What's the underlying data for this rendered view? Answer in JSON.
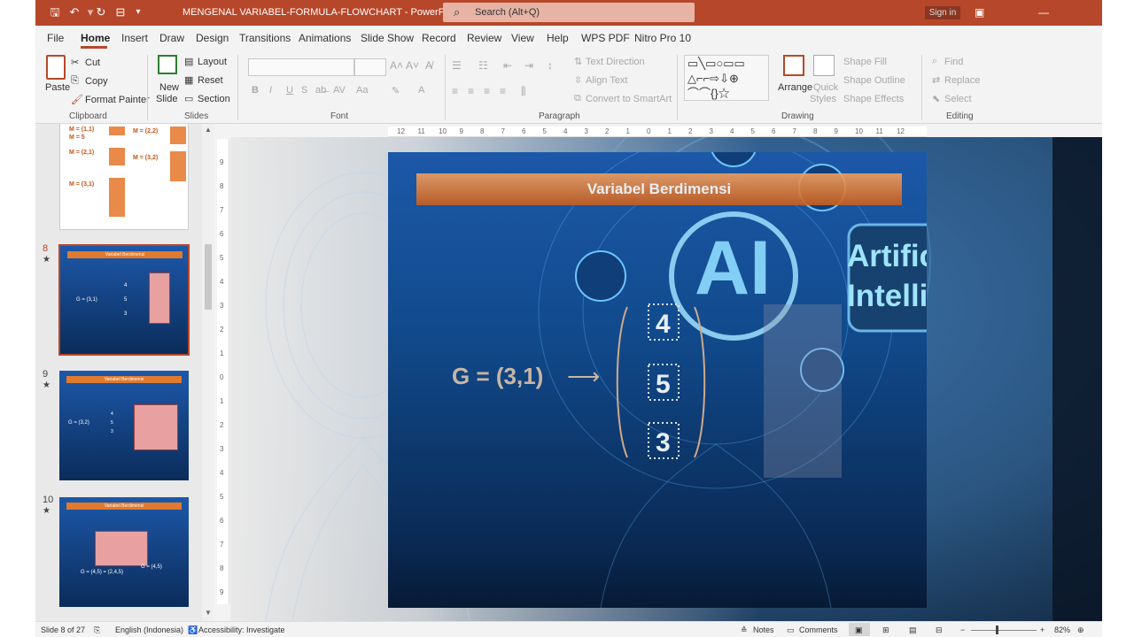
{
  "window": {
    "title": "MENGENAL VARIABEL-FORMULA-FLOWCHART  -  PowerPoint",
    "search_placeholder": "Search (Alt+Q)",
    "signin": "Sign in"
  },
  "menu": [
    "File",
    "Home",
    "Insert",
    "Draw",
    "Design",
    "Transitions",
    "Animations",
    "Slide Show",
    "Record",
    "Review",
    "View",
    "Help",
    "WPS PDF",
    "Nitro Pro 10"
  ],
  "ribbon": {
    "clipboard": {
      "paste": "Paste",
      "cut": "Cut",
      "copy": "Copy",
      "format_painter": "Format Painter",
      "group": "Clipboard"
    },
    "slides": {
      "new_slide_1": "New",
      "new_slide_2": "Slide",
      "layout": "Layout",
      "reset": "Reset",
      "section": "Section",
      "group": "Slides"
    },
    "font": {
      "group": "Font"
    },
    "paragraph": {
      "text_direction": "Text Direction",
      "align_text": "Align Text",
      "convert": "Convert to SmartArt",
      "group": "Paragraph"
    },
    "drawing": {
      "arrange": "Arrange",
      "quick_1": "Quick",
      "quick_2": "Styles",
      "shape_fill": "Shape Fill",
      "shape_outline": "Shape Outline",
      "shape_effects": "Shape Effects",
      "group": "Drawing"
    },
    "editing": {
      "find": "Find",
      "replace": "Replace",
      "select": "Select",
      "group": "Editing"
    }
  },
  "thumbnails": {
    "slide7": {
      "labels": [
        "M = (1,1)",
        "M = 5",
        "M = (2,1)",
        "M = (3,1)",
        "M = (2,2)",
        "M = (3,2)"
      ]
    },
    "slide8": {
      "num": "8",
      "star": "★",
      "header": "Variabel Berdimensi",
      "formula": "G = (3,1)",
      "vals": [
        "4",
        "5",
        "3"
      ]
    },
    "slide9": {
      "num": "9",
      "star": "★",
      "header": "Variabel Berdimensi",
      "formula": "G = (3,2)",
      "vals": [
        "4",
        "5",
        "3"
      ]
    },
    "slide10": {
      "num": "10",
      "star": "★",
      "header": "Variabel Berdimensi",
      "formula_a": "G = (4,5) = (2,4,5)",
      "formula_b": "G = (4,5)"
    }
  },
  "slide": {
    "header": "Variabel Berdimensi",
    "formula": "G = (3,1)",
    "arrow": "⟶",
    "values": [
      "4",
      "5",
      "3"
    ],
    "overlay_ai": "AI",
    "overlay_text_1": "Artificial",
    "overlay_text_2": "Intelligence"
  },
  "ruler": {
    "h": [
      "12",
      "11",
      "10",
      "9",
      "8",
      "7",
      "6",
      "5",
      "4",
      "3",
      "2",
      "1",
      "0",
      "1",
      "2",
      "3",
      "4",
      "5",
      "6",
      "7",
      "8",
      "9",
      "10",
      "11",
      "12"
    ],
    "v": [
      "9",
      "8",
      "7",
      "6",
      "5",
      "4",
      "3",
      "2",
      "1",
      "0",
      "1",
      "2",
      "3",
      "4",
      "5",
      "6",
      "7",
      "8",
      "9"
    ]
  },
  "status": {
    "slide": "Slide 8 of 27",
    "language": "English (Indonesia)",
    "accessibility": "Accessibility: Investigate",
    "notes": "Notes",
    "comments": "Comments",
    "zoom": "82%"
  },
  "colors": {
    "accent": "#b7472a",
    "header_bar": "#e07a2e",
    "slide_bg": "#1a4f98",
    "thumb_cell": "#e98a4a"
  }
}
